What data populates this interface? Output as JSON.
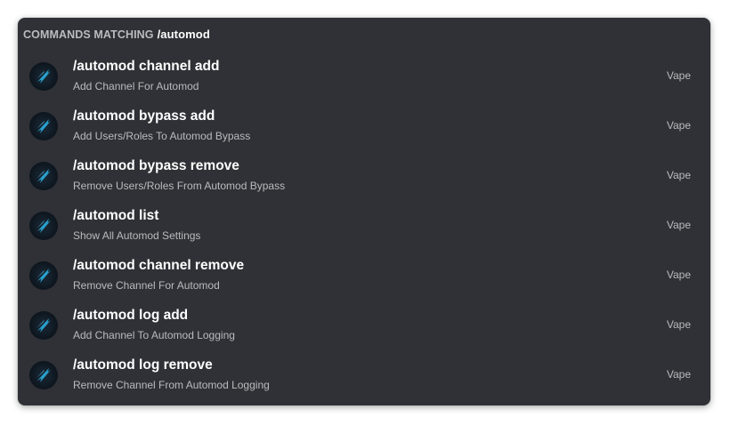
{
  "header": {
    "prefix": "COMMANDS MATCHING",
    "query": "/automod"
  },
  "commands": [
    {
      "name": "/automod channel add",
      "description": "Add Channel For Automod",
      "source": "Vape",
      "icon": "vape-bot-avatar-icon"
    },
    {
      "name": "/automod bypass add",
      "description": "Add Users/Roles To Automod Bypass",
      "source": "Vape",
      "icon": "vape-bot-avatar-icon"
    },
    {
      "name": "/automod bypass remove",
      "description": "Remove Users/Roles From Automod Bypass",
      "source": "Vape",
      "icon": "vape-bot-avatar-icon"
    },
    {
      "name": "/automod list",
      "description": "Show All Automod Settings",
      "source": "Vape",
      "icon": "vape-bot-avatar-icon"
    },
    {
      "name": "/automod channel remove",
      "description": "Remove Channel For Automod",
      "source": "Vape",
      "icon": "vape-bot-avatar-icon"
    },
    {
      "name": "/automod log add",
      "description": "Add Channel To Automod Logging",
      "source": "Vape",
      "icon": "vape-bot-avatar-icon"
    },
    {
      "name": "/automod log remove",
      "description": "Remove Channel From Automod Logging",
      "source": "Vape",
      "icon": "vape-bot-avatar-icon"
    }
  ],
  "colors": {
    "panel_bg": "#2f3136",
    "text_primary": "#ffffff",
    "text_muted": "#b9bbbe",
    "accent_icon": "#2aa8d6"
  }
}
